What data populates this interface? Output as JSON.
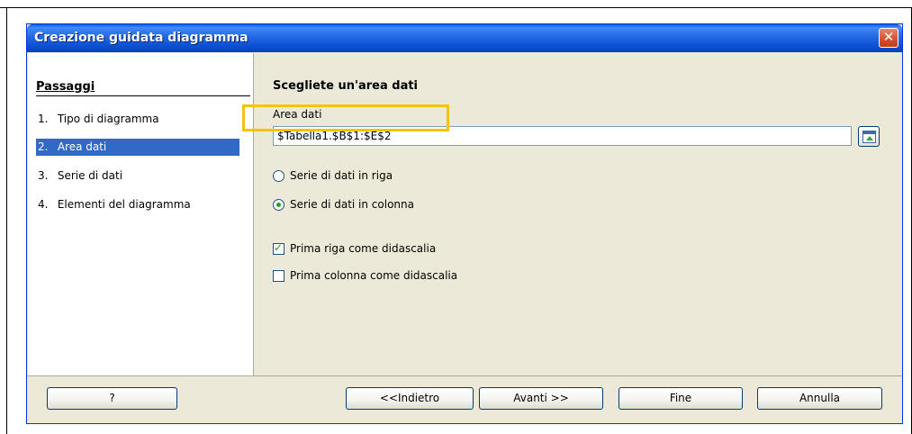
{
  "window": {
    "title": "Creazione guidata diagramma",
    "close_glyph": "✕"
  },
  "steps": {
    "heading": "Passaggi",
    "items": [
      {
        "num": "1.",
        "label": "Tipo di diagramma"
      },
      {
        "num": "2.",
        "label": "Area dati"
      },
      {
        "num": "3.",
        "label": "Serie di dati"
      },
      {
        "num": "4.",
        "label": "Elementi del diagramma"
      }
    ],
    "selected_index": 1
  },
  "data_range": {
    "title": "Scegliete un'area dati",
    "label": "Area dati",
    "value": "$Tabella1.$B$1:$E$2",
    "shrink_icon": "select-range-icon"
  },
  "options": {
    "series_in_rows": {
      "label": "Serie di dati in riga",
      "selected": false
    },
    "series_in_columns": {
      "label": "Serie di dati in colonna",
      "selected": true
    },
    "first_row_label": {
      "label": "Prima riga come didascalia",
      "checked": true
    },
    "first_column_label": {
      "label": "Prima colonna come didascalia",
      "checked": false
    }
  },
  "buttons": {
    "help": "?",
    "back": "<<Indietro",
    "next": "Avanti >>",
    "finish": "Fine",
    "cancel": "Annulla"
  },
  "colors": {
    "title_bar": "#0a4fd0",
    "selection": "#316ac5",
    "highlight_border": "#f5c20f"
  }
}
